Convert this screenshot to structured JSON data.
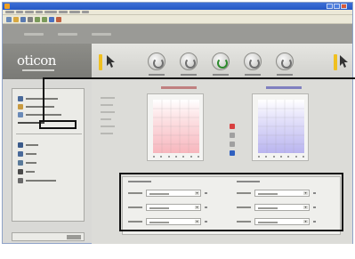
{
  "app": {
    "title": "",
    "window_controls": [
      "minimize-icon",
      "maximize-icon",
      "close-icon"
    ]
  },
  "menu": {
    "items": [
      "",
      "",
      "",
      "",
      "",
      "",
      "",
      ""
    ]
  },
  "toolbar": {
    "icons": [
      "new-icon",
      "open-icon",
      "save-icon",
      "print-icon",
      "undo-icon",
      "redo-icon",
      "help-icon",
      "connect-icon"
    ]
  },
  "brand": {
    "logo": "oticon",
    "tagline": ""
  },
  "tools": [
    {
      "icon": "dial-icon",
      "label": ""
    },
    {
      "icon": "dial-icon",
      "label": ""
    },
    {
      "icon": "gauge-icon",
      "label": ""
    },
    {
      "icon": "dial-icon",
      "label": ""
    },
    {
      "icon": "dial-icon",
      "label": ""
    }
  ],
  "sidebar": {
    "group1": [
      {
        "icon": "person-icon",
        "label": ""
      },
      {
        "icon": "folder-icon",
        "label": ""
      },
      {
        "icon": "document-icon",
        "label": ""
      }
    ],
    "selected": {
      "label": ""
    },
    "group2": [
      {
        "icon": "headset-icon",
        "label": ""
      },
      {
        "icon": "person-icon",
        "label": ""
      },
      {
        "icon": "chart-icon",
        "label": ""
      },
      {
        "icon": "hearing-aid-icon",
        "label": ""
      },
      {
        "icon": "settings-icon",
        "label": ""
      }
    ],
    "bottom_button": ""
  },
  "charts": {
    "right_ear": {
      "title": "",
      "color": "#e87080"
    },
    "left_ear": {
      "title": "",
      "color": "#7060d0"
    },
    "scale_colors": [
      "#d84040",
      "#a0a0a0",
      "#3060c0"
    ]
  },
  "chart_data": [
    {
      "type": "line",
      "title": "",
      "xlabel": "",
      "ylabel": "",
      "series": []
    },
    {
      "type": "line",
      "title": "",
      "xlabel": "",
      "ylabel": "",
      "series": []
    }
  ],
  "fitting": {
    "left_heading": "",
    "right_heading": "",
    "fields": [
      {
        "label": "",
        "value": ""
      },
      {
        "label": "",
        "value": ""
      },
      {
        "label": "",
        "value": ""
      }
    ]
  }
}
